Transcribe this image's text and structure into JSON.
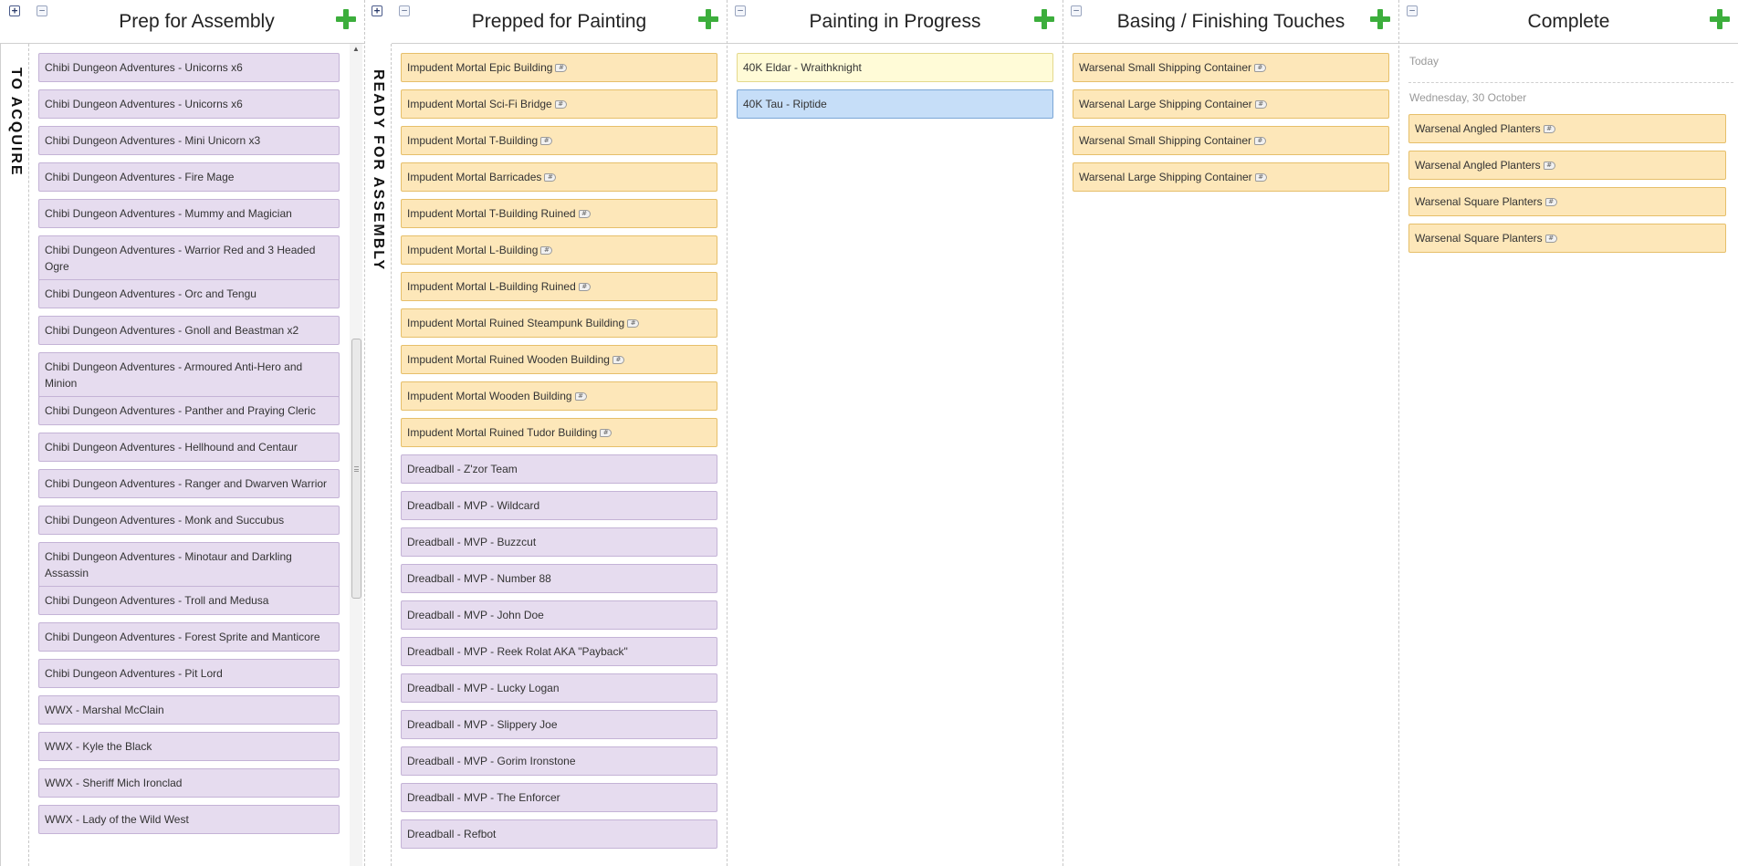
{
  "lanes": {
    "prep": {
      "title": "Prep for Assembly"
    },
    "prepped": {
      "title": "Prepped for Painting"
    },
    "painting": {
      "title": "Painting in Progress"
    },
    "basing": {
      "title": "Basing / Finishing Touches"
    },
    "complete": {
      "title": "Complete"
    }
  },
  "controls": {
    "expand_symbol": "+",
    "collapse_symbol": "−",
    "scroll_up_symbol": "▲",
    "tag_symbol": "#"
  },
  "side_lanes": {
    "to_acquire": "TO ACQUIRE",
    "ready_for_assembly": "READY FOR ASSEMBLY"
  },
  "prep_cards": [
    "Chibi Dungeon Adventures - Unicorns x6",
    "Chibi Dungeon Adventures - Unicorns x6",
    "Chibi Dungeon Adventures - Mini Unicorn x3",
    "Chibi Dungeon Adventures - Fire Mage",
    "Chibi Dungeon Adventures - Mummy and Magician",
    "Chibi Dungeon Adventures - Warrior Red and 3 Headed Ogre",
    "Chibi Dungeon Adventures - Orc and Tengu",
    "Chibi Dungeon Adventures - Gnoll and Beastman x2",
    "Chibi Dungeon Adventures - Armoured Anti-Hero and Minion",
    "Chibi Dungeon Adventures - Panther and Praying Cleric",
    "Chibi Dungeon Adventures - Hellhound and Centaur",
    "Chibi Dungeon Adventures - Ranger and Dwarven Warrior",
    "Chibi Dungeon Adventures - Monk and Succubus",
    "Chibi Dungeon Adventures - Minotaur and Darkling Assassin",
    "Chibi Dungeon Adventures - Troll and Medusa",
    "Chibi Dungeon Adventures - Forest Sprite and Manticore",
    "Chibi Dungeon Adventures - Pit Lord",
    "WWX - Marshal McClain",
    "WWX - Kyle the Black",
    "WWX - Sheriff Mich Ironclad",
    "WWX - Lady of the Wild West"
  ],
  "prepped_cards": [
    {
      "text": "Impudent Mortal Epic Building",
      "color": "orange",
      "tag": true
    },
    {
      "text": "Impudent Mortal Sci-Fi Bridge",
      "color": "orange",
      "tag": true
    },
    {
      "text": "Impudent Mortal T-Building",
      "color": "orange",
      "tag": true
    },
    {
      "text": "Impudent Mortal Barricades",
      "color": "orange",
      "tag": true
    },
    {
      "text": "Impudent Mortal T-Building Ruined",
      "color": "orange",
      "tag": true
    },
    {
      "text": "Impudent Mortal L-Building",
      "color": "orange",
      "tag": true
    },
    {
      "text": "Impudent Mortal L-Building Ruined",
      "color": "orange",
      "tag": true
    },
    {
      "text": "Impudent Mortal Ruined Steampunk Building",
      "color": "orange",
      "tag": true
    },
    {
      "text": "Impudent Mortal Ruined Wooden Building",
      "color": "orange",
      "tag": true
    },
    {
      "text": "Impudent Mortal Wooden Building",
      "color": "orange",
      "tag": true
    },
    {
      "text": "Impudent Mortal Ruined Tudor Building",
      "color": "orange",
      "tag": true
    },
    {
      "text": "Dreadball - Z'zor Team",
      "color": "lav",
      "tag": false
    },
    {
      "text": "Dreadball - MVP - Wildcard",
      "color": "lav",
      "tag": false
    },
    {
      "text": "Dreadball - MVP - Buzzcut",
      "color": "lav",
      "tag": false
    },
    {
      "text": "Dreadball - MVP - Number 88",
      "color": "lav",
      "tag": false
    },
    {
      "text": "Dreadball - MVP - John Doe",
      "color": "lav",
      "tag": false
    },
    {
      "text": "Dreadball - MVP - Reek Rolat AKA \"Payback\"",
      "color": "lav",
      "tag": false
    },
    {
      "text": "Dreadball - MVP - Lucky Logan",
      "color": "lav",
      "tag": false
    },
    {
      "text": "Dreadball - MVP - Slippery Joe",
      "color": "lav",
      "tag": false
    },
    {
      "text": "Dreadball - MVP - Gorim Ironstone",
      "color": "lav",
      "tag": false
    },
    {
      "text": "Dreadball - MVP - The Enforcer",
      "color": "lav",
      "tag": false
    },
    {
      "text": "Dreadball - Refbot",
      "color": "lav",
      "tag": false
    }
  ],
  "painting_cards": [
    {
      "text": "40K Eldar - Wraithknight",
      "color": "yellow"
    },
    {
      "text": "40K Tau - Riptide",
      "color": "blue"
    }
  ],
  "basing_cards": [
    "Warsenal Small Shipping Container",
    "Warsenal Large Shipping Container",
    "Warsenal Small Shipping Container",
    "Warsenal Large Shipping Container"
  ],
  "complete": {
    "today_label": "Today",
    "date_label": "Wednesday, 30 October",
    "cards": [
      "Warsenal Angled Planters",
      "Warsenal Angled Planters",
      "Warsenal Square Planters",
      "Warsenal Square Planters"
    ]
  },
  "colors": {
    "orange_card": "#fde7b9",
    "lavender_card": "#e6dcef",
    "yellow_card": "#fffbd7",
    "blue_card": "#c6def8",
    "add_button": "#3cae3c"
  }
}
